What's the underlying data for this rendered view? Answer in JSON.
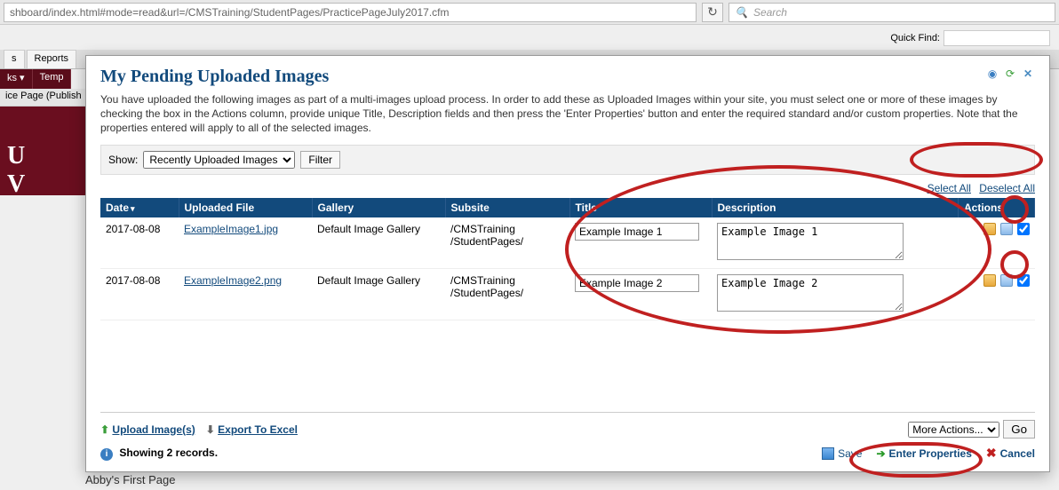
{
  "browser": {
    "url": "shboard/index.html#mode=read&url=/CMSTraining/StudentPages/PracticePageJuly2017.cfm",
    "search_placeholder": "Search"
  },
  "bg": {
    "quickfind_label": "Quick Find:",
    "tab_s": "s",
    "tab_reports": "Reports",
    "darktab1": "ks ▾",
    "darktab2": "Temp",
    "pub": "ice Page (Publish",
    "maroon": "U\nV",
    "bottom": "Abby's First Page"
  },
  "modal": {
    "title": "My Pending Uploaded Images",
    "desc": "You have uploaded the following images as part of a multi-images upload process. In order to add these as Uploaded Images within your site, you must select one or more of these images by checking the box in the Actions column, provide unique Title, Description fields and then press the 'Enter Properties' button and enter the required standard and/or custom properties. Note that the properties entered will apply to all of the selected images.",
    "show_label": "Show:",
    "show_value": "Recently Uploaded Images",
    "filter_label": "Filter",
    "select_all": "Select All",
    "deselect_all": "Deselect All",
    "columns": {
      "date": "Date",
      "file": "Uploaded File",
      "gallery": "Gallery",
      "subsite": "Subsite",
      "title": "Title",
      "desc": "Description",
      "actions": "Actions"
    },
    "rows": [
      {
        "date": "2017-08-08",
        "file": "ExampleImage1.jpg",
        "gallery": "Default Image Gallery",
        "subsite": "/CMSTraining /StudentPages/",
        "title": "Example Image 1",
        "desc": "Example Image 1",
        "checked": true
      },
      {
        "date": "2017-08-08",
        "file": "ExampleImage2.png",
        "gallery": "Default Image Gallery",
        "subsite": "/CMSTraining /StudentPages/",
        "title": "Example Image 2",
        "desc": "Example Image 2",
        "checked": true
      }
    ],
    "upload_link": "Upload Image(s)",
    "export_link": "Export To Excel",
    "more_actions": "More Actions...",
    "go": "Go",
    "showing": "Showing 2 records.",
    "save": "Save",
    "enter_props": "Enter Properties",
    "cancel": "Cancel"
  }
}
